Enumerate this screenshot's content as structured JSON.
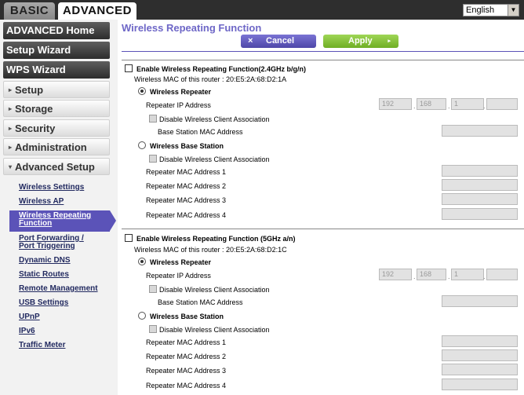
{
  "tabs": {
    "basic": "BASIC",
    "advanced": "ADVANCED"
  },
  "language": {
    "selected": "English"
  },
  "sidebar": {
    "buttons": [
      {
        "label": "ADVANCED Home"
      },
      {
        "label": "Setup Wizard"
      },
      {
        "label": "WPS Wizard"
      }
    ],
    "menus": [
      {
        "label": "Setup",
        "arrow": "▸"
      },
      {
        "label": "Storage",
        "arrow": "▸"
      },
      {
        "label": "Security",
        "arrow": "▸"
      },
      {
        "label": "Administration",
        "arrow": "▸"
      },
      {
        "label": "Advanced Setup",
        "arrow": "▾"
      }
    ],
    "sublinks": [
      {
        "label": "Wireless Settings"
      },
      {
        "label": "Wireless AP"
      },
      {
        "label": "Wireless Repeating",
        "label2": "Function"
      },
      {
        "label": "Port Forwarding /",
        "label2": "Port Triggering"
      },
      {
        "label": "Dynamic DNS"
      },
      {
        "label": "Static Routes"
      },
      {
        "label": "Remote Management"
      },
      {
        "label": "USB Settings"
      },
      {
        "label": "UPnP"
      },
      {
        "label": "IPv6"
      },
      {
        "label": "Traffic Meter"
      }
    ]
  },
  "main": {
    "title": "Wireless Repeating Function",
    "cancel_label": "Cancel",
    "cancel_icon": "×",
    "apply_label": "Apply",
    "apply_icon": "▸",
    "sections": [
      {
        "enable_label": "Enable Wireless Repeating Function(2.4GHz b/g/n)",
        "mac_text": "Wireless MAC of this router : 20:E5:2A:68:D2:1A",
        "repeater_label": "Wireless Repeater",
        "repeater_ip_label": "Repeater IP Address",
        "ip": [
          "192",
          "168",
          "1",
          ""
        ],
        "disable_assoc_label": "Disable Wireless Client Association",
        "base_mac_label": "Base Station MAC Address",
        "base_station_label": "Wireless Base Station",
        "disable_assoc_label2": "Disable Wireless Client Association",
        "repeater_macs": [
          "Repeater MAC Address 1",
          "Repeater MAC Address 2",
          "Repeater MAC Address 3",
          "Repeater MAC Address 4"
        ]
      },
      {
        "enable_label": "Enable Wireless Repeating Function (5GHz a/n)",
        "mac_text": "Wireless MAC of this router : 20:E5:2A:68:D2:1C",
        "repeater_label": "Wireless Repeater",
        "repeater_ip_label": "Repeater IP Address",
        "ip": [
          "192",
          "168",
          "1",
          ""
        ],
        "disable_assoc_label": "Disable Wireless Client Association",
        "base_mac_label": "Base Station MAC Address",
        "base_station_label": "Wireless Base Station",
        "disable_assoc_label2": "Disable Wireless Client Association",
        "repeater_macs": [
          "Repeater MAC Address 1",
          "Repeater MAC Address 2",
          "Repeater MAC Address 3",
          "Repeater MAC Address 4"
        ]
      }
    ]
  }
}
